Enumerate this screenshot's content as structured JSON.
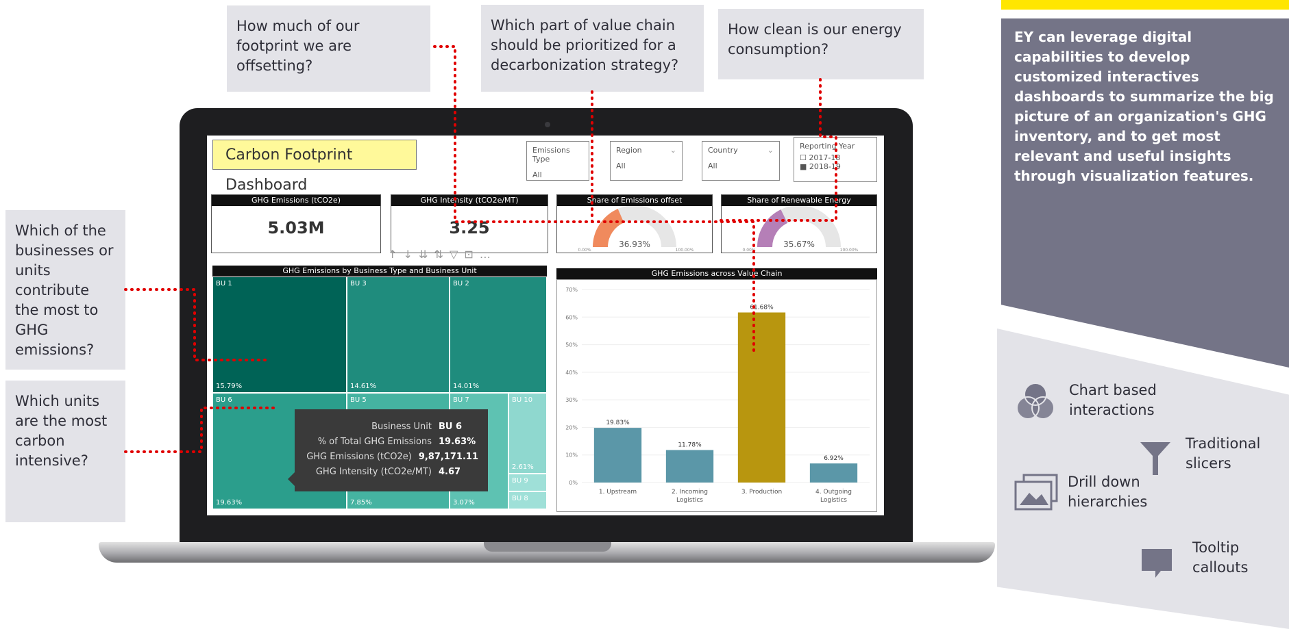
{
  "questions": {
    "offsetting": "How much of our footprint we are offsetting?",
    "value_chain": "Which part of value chain should be prioritized for a decarbonization strategy?",
    "clean_energy": "How clean is our energy consumption?",
    "businesses": "Which of the businesses or units contribute the most to GHG emissions?",
    "carbon_intensive": "Which units are the most carbon intensive?"
  },
  "dashboard": {
    "title": "Carbon Footprint Dashboard",
    "slicers": [
      {
        "label": "Emissions Type",
        "value": "All"
      },
      {
        "label": "Region",
        "value": "All"
      },
      {
        "label": "Country",
        "value": "All"
      }
    ],
    "reporting_year": {
      "label": "Reporting Year",
      "options": [
        "2017-18",
        "2018-19"
      ]
    },
    "kpis": {
      "ghg_emissions": {
        "label": "GHG Emissions (tCO2e)",
        "value": "5.03M"
      },
      "ghg_intensity": {
        "label": "GHG Intensity (tCO2e/MT)",
        "value": "3.25"
      },
      "offset_share": {
        "label": "Share of Emissions offset",
        "value": "36.93%",
        "min": "0.00%",
        "max": "100.00%",
        "fraction": 0.3693
      },
      "renewable_share": {
        "label": "Share of Renewable Energy",
        "value": "35.67%",
        "min": "0.00%",
        "max": "100.00%",
        "fraction": 0.3567
      }
    },
    "toolbar": "↑ ↓ ⇊ ⇅ ▽ ⊡ …",
    "treemap": {
      "title": "GHG Emissions by Business Type and Business Unit",
      "cells": [
        {
          "name": "BU 1",
          "pct": "15.79%"
        },
        {
          "name": "BU 3",
          "pct": "14.61%"
        },
        {
          "name": "BU 2",
          "pct": "14.01%"
        },
        {
          "name": "BU 6",
          "pct": "19.63%"
        },
        {
          "name": "BU 5",
          "pct": "7.85%"
        },
        {
          "name": "BU 7",
          "pct": "3.07%"
        },
        {
          "name": "BU 10",
          "pct": "2.61%"
        },
        {
          "name": "BU 9",
          "pct": ""
        },
        {
          "name": "BU 8",
          "pct": ""
        }
      ]
    },
    "tooltip": {
      "rows": [
        {
          "k": "Business Unit",
          "v": "BU 6"
        },
        {
          "k": "% of Total GHG Emissions",
          "v": "19.63%"
        },
        {
          "k": "GHG Emissions (tCO2e)",
          "v": "9,87,171.11"
        },
        {
          "k": "GHG Intensity (tCO2e/MT)",
          "v": "4.67"
        }
      ]
    }
  },
  "chart_data": {
    "type": "bar",
    "title": "GHG Emissions across Value Chain",
    "categories": [
      "1. Upstream",
      "2. Incoming Logistics",
      "3. Production",
      "4. Outgoing Logistics"
    ],
    "values": [
      19.83,
      11.78,
      61.68,
      6.92
    ],
    "data_labels": [
      "19.83%",
      "11.78%",
      "61.68%",
      "6.92%"
    ],
    "ylim": [
      0,
      70
    ],
    "yticks": [
      "0%",
      "10%",
      "20%",
      "30%",
      "40%",
      "50%",
      "60%",
      "70%"
    ],
    "colors": [
      "#5b97a8",
      "#5b97a8",
      "#b8960f",
      "#5b97a8"
    ]
  },
  "side_panel": {
    "description": "EY can leverage digital capabilities to develop customized interactives dashboards to summarize the big picture of an organization's GHG inventory, and to get most relevant and useful insights through visualization features.",
    "features": {
      "chart": "Chart based interactions",
      "slicers": "Traditional slicers",
      "drill": "Drill down hierarchies",
      "tooltip": "Tooltip callouts"
    }
  },
  "colors": {
    "dots": "#e00000",
    "brand_yellow": "#ffe600",
    "panel_dark": "#747487",
    "panel_light": "#e3e3e8"
  }
}
